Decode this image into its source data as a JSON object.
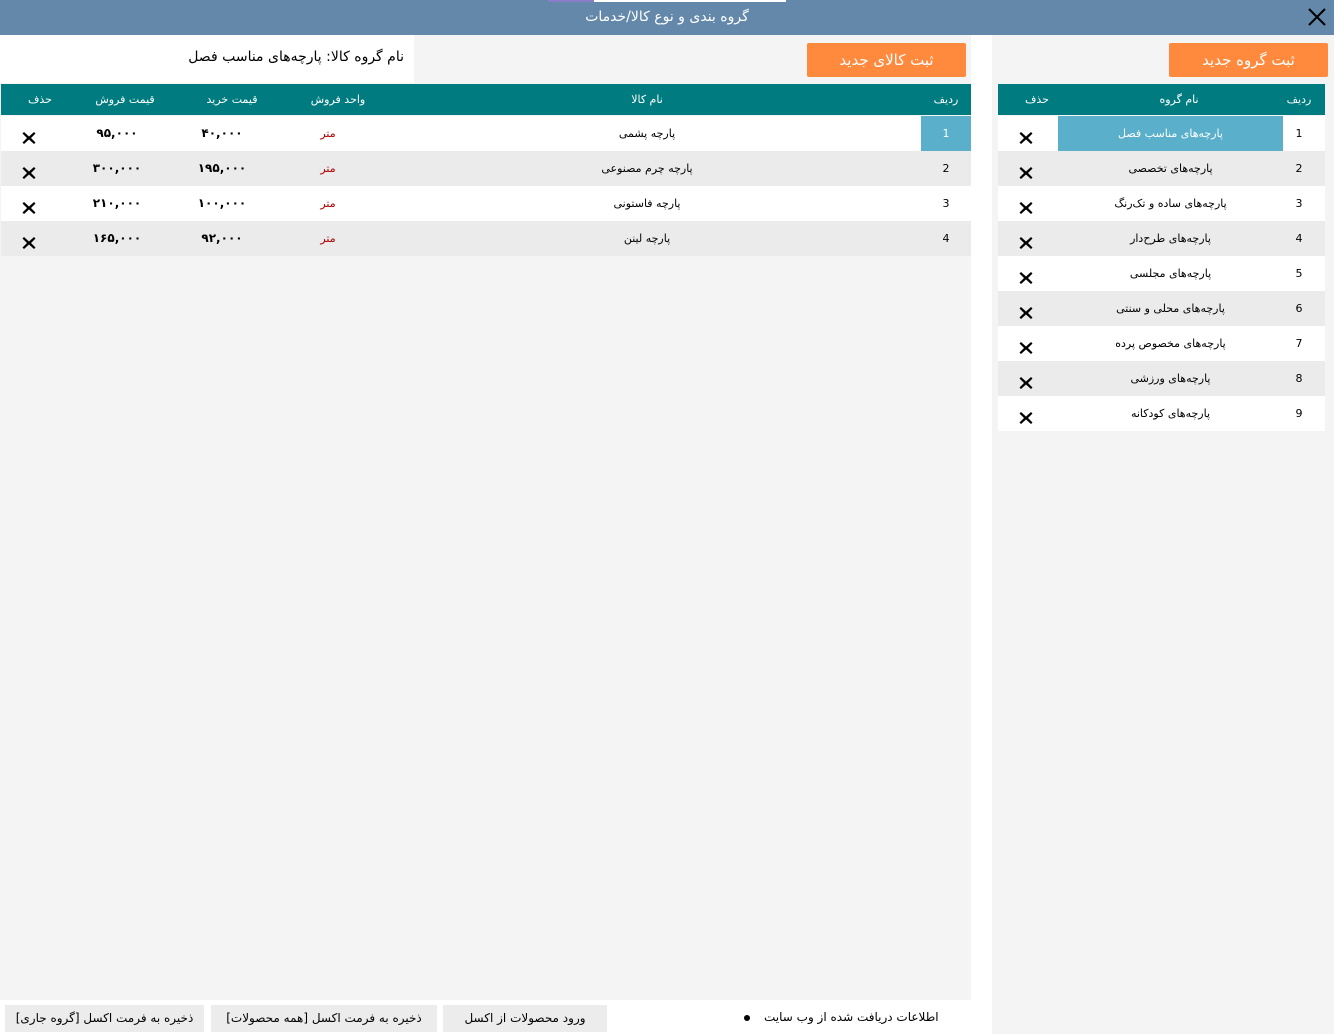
{
  "window": {
    "title": "گروه بندی و نوع کالا/خدمات"
  },
  "groups_panel": {
    "add_button_label": "ثبت گروه جدید",
    "columns": {
      "row": "ردیف",
      "name": "نام گروه",
      "delete": "حذف"
    },
    "selected_index": 0,
    "rows": [
      {
        "row": "1",
        "name": "پارچه‌های مناسب فصل"
      },
      {
        "row": "2",
        "name": "پارچه‌های تخصصی"
      },
      {
        "row": "3",
        "name": "پارچه‌های ساده و تک‌رنگ"
      },
      {
        "row": "4",
        "name": "پارچه‌های طرح‌دار"
      },
      {
        "row": "5",
        "name": "پارچه‌های مجلسی"
      },
      {
        "row": "6",
        "name": "پارچه‌های محلی و سنتی"
      },
      {
        "row": "7",
        "name": "پارچه‌های مخصوص پرده"
      },
      {
        "row": "8",
        "name": "پارچه‌های ورزشی"
      },
      {
        "row": "9",
        "name": "پارچه‌های کودکانه"
      }
    ]
  },
  "products_panel": {
    "group_label": "نام گروه کالا:  پارچه‌های مناسب فصل",
    "add_button_label": "ثبت کالای جدید",
    "columns": {
      "row": "ردیف",
      "name": "نام کالا",
      "unit": "واحد فروش",
      "buy_price": "قیمت خرید",
      "sell_price": "قیمت فروش",
      "delete": "حذف"
    },
    "selected_index": 0,
    "rows": [
      {
        "row": "1",
        "name": "پارچه پشمی",
        "unit": "متر",
        "buy_price": "۴۰,۰۰۰",
        "sell_price": "۹۵,۰۰۰"
      },
      {
        "row": "2",
        "name": "پارچه چرم مصنوعی",
        "unit": "متر",
        "buy_price": "۱۹۵,۰۰۰",
        "sell_price": "۳۰۰,۰۰۰"
      },
      {
        "row": "3",
        "name": "پارچه فاستونی",
        "unit": "متر",
        "buy_price": "۱۰۰,۰۰۰",
        "sell_price": "۲۱۰,۰۰۰"
      },
      {
        "row": "4",
        "name": "پارچه لینن",
        "unit": "متر",
        "buy_price": "۹۲,۰۰۰",
        "sell_price": "۱۶۵,۰۰۰"
      }
    ]
  },
  "bottom_bar": {
    "save_current_group": "ذخیره به فرمت اکسل [گروه جاری]",
    "save_all_products": "ذخیره به فرمت اکسل [همه محصولات]",
    "import_from_excel": "ورود محصولات از اکسل",
    "web_info_label": "اطلاعات دریافت شده از وب سایت"
  },
  "colors": {
    "titlebar": "#6388aa",
    "header": "#007b7f",
    "accent_orange": "#ff8a3d",
    "selection": "#5aafca",
    "unit_text": "#b00000"
  },
  "icons": {
    "close": "close-icon",
    "delete": "delete-x-icon"
  }
}
